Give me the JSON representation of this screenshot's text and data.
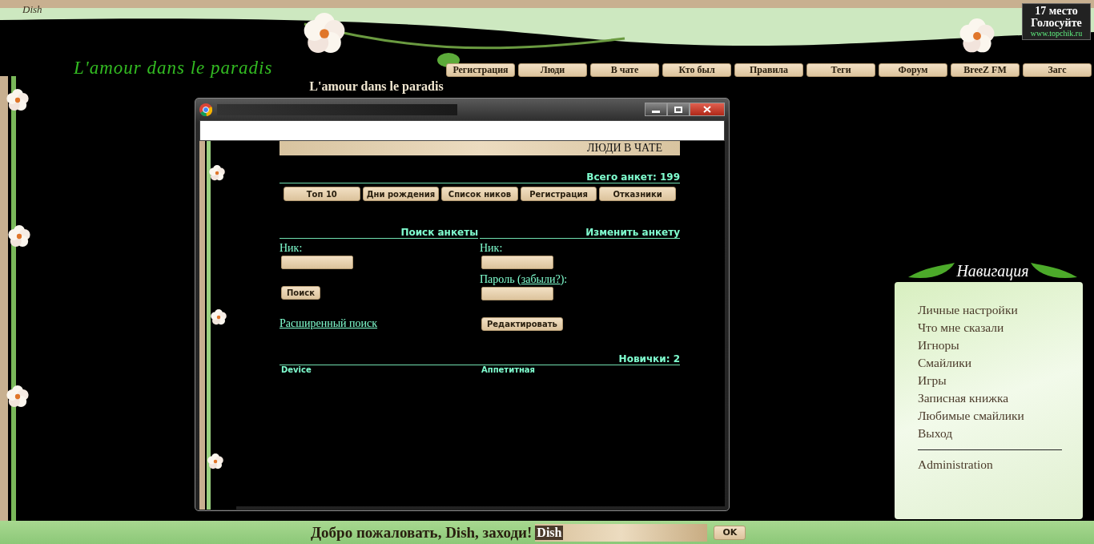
{
  "user": "Dish",
  "site_logo": "L'amour dans le paradis",
  "rating_badge": {
    "place": "17 место",
    "action": "Голосуйте",
    "site": "www.topchik.ru"
  },
  "nav": [
    "Регистрация",
    "Люди",
    "В чате",
    "Кто был",
    "Правила",
    "Теги",
    "Форум",
    "BreeZ FM",
    "Загс"
  ],
  "page_title": "L'amour dans le paradis",
  "popup": {
    "heading": "ЛЮДИ В ЧАТЕ",
    "total": "Всего анкет: 199",
    "tabs": [
      "Топ 10",
      "Дни рождения",
      "Список ников",
      "Регистрация",
      "Отказники"
    ],
    "search": {
      "title": "Поиск анкеты",
      "nick_label": "Ник:",
      "button": "Поиск",
      "advanced_link": "Расширенный поиск"
    },
    "edit": {
      "title": "Изменить анкету",
      "nick_label": "Ник:",
      "password_label": "Пароль (",
      "forgot_link": "забыли?",
      "password_suffix": "):",
      "button": "Редактировать"
    },
    "newcomers": {
      "title": "Новички: 2",
      "names": [
        "Device",
        "Аппетитная"
      ]
    }
  },
  "navigation": {
    "title": "Навигация",
    "items": [
      "Личные настройки",
      "Что мне сказали",
      "Игноры",
      "Смайлики",
      "Игры",
      "Записная книжка",
      "Любимые смайлики",
      "Выход"
    ],
    "admin": "Administration"
  },
  "footer": {
    "greeting": "Добро пожаловать, Dish, заходи!",
    "input_value": "Dish",
    "button": "OK"
  }
}
